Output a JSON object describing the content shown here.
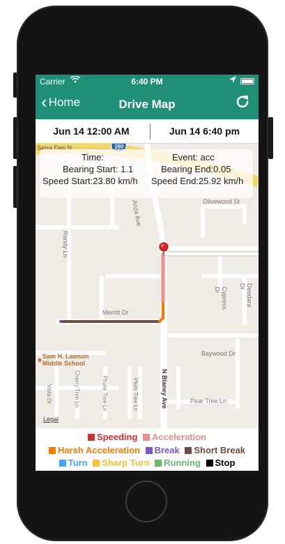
{
  "status_bar": {
    "carrier": "Carrier",
    "time": "6:40 PM"
  },
  "nav": {
    "back_label": "Home",
    "title": "Drive Map"
  },
  "date_range": {
    "start": "Jun 14  12:00 AM",
    "end": "Jun 14 6:40 pm"
  },
  "info": {
    "time": "Time:",
    "event": "Event: acc",
    "bearing_start": "Bearing Start: 1.1",
    "bearing_end": "Bearing End:0.05",
    "speed_start": "Speed Start:23.80 km/h",
    "speed_end": "Speed End:25.92 km/h"
  },
  "map": {
    "streets": [
      "Serra Fwy N",
      "Olivewood St",
      "Anza Ave",
      "Randy Ln",
      "Cypress Dr",
      "Deodara Dr",
      "Merritt Dr",
      "Baywood Dr",
      "Vista Dr",
      "Cherry Tree Ln",
      "Prune Tree Ln",
      "Plum Tree Ln",
      "N Blaney Ave",
      "Pear Tree Ln"
    ],
    "highway_shield": "280",
    "poi": "Sam H. Lawson Middle School",
    "legal": "Legal"
  },
  "legend": [
    {
      "label": "Speeding",
      "color": "#d32f2f"
    },
    {
      "label": "Acceleration",
      "color": "#ef8c8c"
    },
    {
      "label": "Harsh Acceleration",
      "color": "#f57c00"
    },
    {
      "label": "Break",
      "color": "#7e57c2"
    },
    {
      "label": "Short Break",
      "color": "#6d4c41"
    },
    {
      "label": "Turn",
      "color": "#42a5f5"
    },
    {
      "label": "Sharp Turn",
      "color": "#fbc02d"
    },
    {
      "label": "Running",
      "color": "#66bb6a"
    },
    {
      "label": "Stop",
      "color": "#000000"
    }
  ],
  "icons": {
    "back": "chevron-left-icon",
    "refresh": "refresh-icon",
    "wifi": "wifi-icon",
    "location": "location-arrow-icon",
    "battery": "battery-icon",
    "pin": "map-pin-icon"
  },
  "colors": {
    "nav_bg": "#1f8f77",
    "route_main": "#6d4c41",
    "route_acc": "#ef8c8c",
    "route_harsh": "#f57c00"
  }
}
